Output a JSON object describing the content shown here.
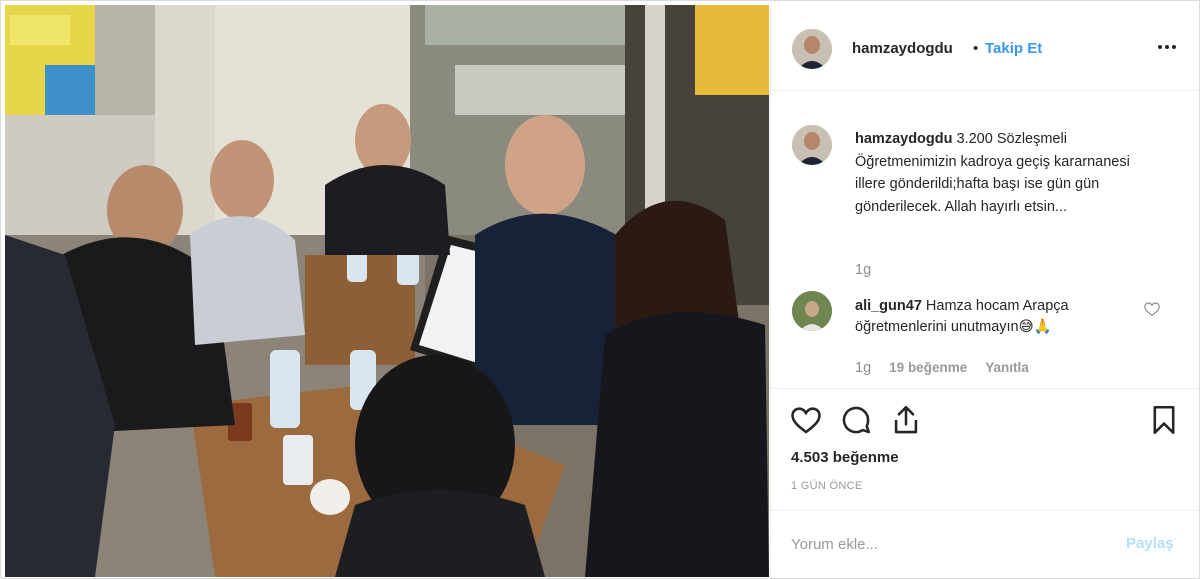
{
  "post": {
    "username": "hamzaydogdu",
    "separator": "•",
    "follow_label": "Takip Et",
    "more_icon": "more-options-icon"
  },
  "caption": {
    "username": "hamzaydogdu",
    "text": "3.200 Sözleşmeli Öğretmenimizin kadroya geçiş kararnanesi illere gönderildi;hafta başı ise gün gün gönderilecek. Allah hayırlı etsin...",
    "time": "1g"
  },
  "comment": {
    "username": "ali_gun47",
    "text": "Hamza hocam Arapça öğretmenlerini unutmayın😅🙏",
    "time": "1g",
    "likes_label": "19 beğenme",
    "reply_label": "Yanıtla"
  },
  "actions": {
    "likes_count": "4.503 beğenme",
    "time_ago": "1 GÜN ÖNCE"
  },
  "add_comment": {
    "placeholder": "Yorum ekle...",
    "post_label": "Paylaş"
  },
  "colors": {
    "accent": "#3897f0",
    "muted": "#8e8e8e",
    "post_disabled": "#b2dffc"
  }
}
